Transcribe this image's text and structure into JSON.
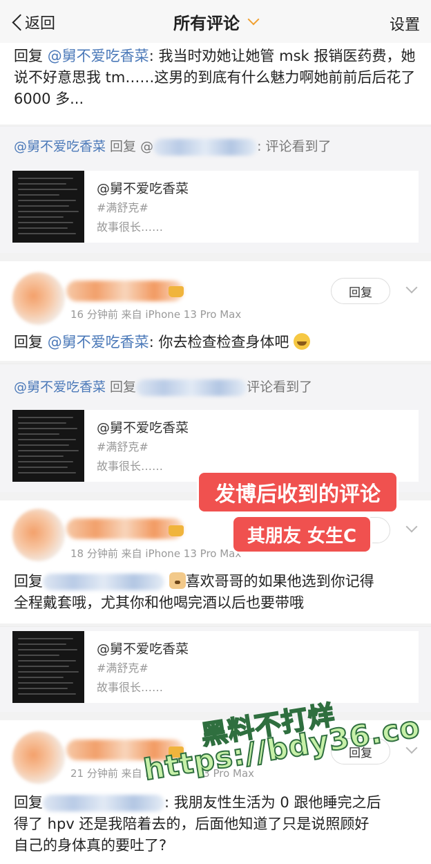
{
  "topbar": {
    "back_label": "返回",
    "title": "所有评论",
    "settings_label": "设置"
  },
  "comments": [
    {
      "reply_prefix": "回复",
      "mention": "@舅不爱吃香菜",
      "text": ": 我当时劝她让她管 msk 报销医药费，她说不好意思我 tm……这男的到底有什么魅力啊她前前后后花了 6000 多...",
      "quote_mention": "@舅不爱吃香菜",
      "quote_reply": " 回复 @",
      "quote_suffix": ": 评论看到了",
      "post_name": "@舅不爱吃香菜",
      "post_tag": "#满舒克#",
      "post_desc": "故事很长……"
    },
    {
      "time": "16 分钟前",
      "source": "来自 iPhone 13 Pro Max",
      "reply_btn": "回复",
      "reply_prefix": "回复",
      "mention": "@舅不爱吃香菜",
      "text": ": 你去检查检查身体吧",
      "emoji": "grinning-sweat-emoji",
      "quote_mention": "@舅不爱吃香菜",
      "quote_reply": " 回复",
      "quote_suffix": "评论看到了",
      "post_name": "@舅不爱吃香菜",
      "post_tag": "#满舒克#",
      "post_desc": "故事很长……"
    },
    {
      "time": "18 分钟前",
      "source": "来自 iPhone 13 Pro Max",
      "reply_prefix": "回复",
      "text_line1": "喜欢哥哥的如果他选到你记得",
      "text_line2": "全程戴套哦，尤其你和他喝完酒以后也要带哦",
      "emoji": "dog-face-emoji",
      "post_name": "@舅不爱吃香菜",
      "post_tag": "#满舒克#",
      "post_desc": "故事很长……"
    },
    {
      "time": "21 分钟前",
      "source_partial": "来自 i",
      "source_tail": "3 Pro Max",
      "reply_btn": "回复",
      "reply_prefix": "回复",
      "text_line1": ": 我朋友性生活为 0 跟他睡完之后",
      "text_line2": "得了 hpv 还是我陪着去的，后面他知道了只是说照顾好",
      "text_line3": "自己的身体真的要吐了?"
    }
  ],
  "stickers": {
    "main": "发博后收到的评论",
    "sub": "其朋友 女生C"
  },
  "watermark": {
    "line1": "黑料不打烊",
    "line2": "https://bdy36.co"
  },
  "colors": {
    "mention": "#4a78b8",
    "sticker": "#f0514f",
    "watermark_fill": "#c7f0a8",
    "watermark_stroke": "#2f6f3f",
    "dropdown_accent": "#f0a030"
  }
}
